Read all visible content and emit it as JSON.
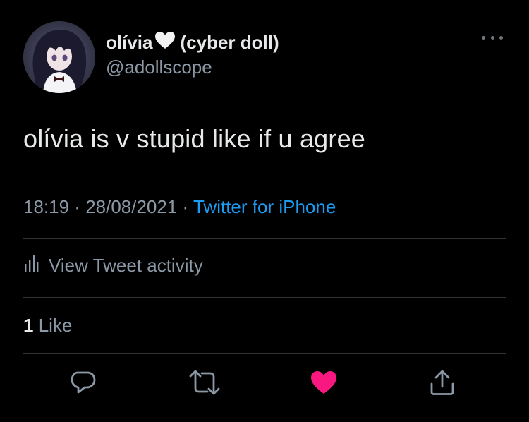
{
  "tweet": {
    "display_name": "olívia",
    "name_suffix": "(cyber doll)",
    "handle": "@adollscope",
    "text": "olívia is v stupid like if u agree",
    "time": "18:19",
    "separator1": " · ",
    "date": "28/08/2021",
    "separator2": " · ",
    "source": "Twitter for iPhone"
  },
  "activity": {
    "label": "View Tweet activity"
  },
  "stats": {
    "likes_count": "1",
    "likes_label": " Like"
  },
  "colors": {
    "background": "#000000",
    "text": "#e7e9ea",
    "muted": "#8b98a5",
    "link": "#1d9bf0",
    "like": "#f91880",
    "divider": "#2f3336"
  },
  "icons": {
    "more": "more-icon",
    "activity": "bar-chart-icon",
    "reply": "reply-icon",
    "retweet": "retweet-icon",
    "like": "heart-filled-icon",
    "share": "share-icon",
    "name_emoji": "white-heart-icon"
  }
}
